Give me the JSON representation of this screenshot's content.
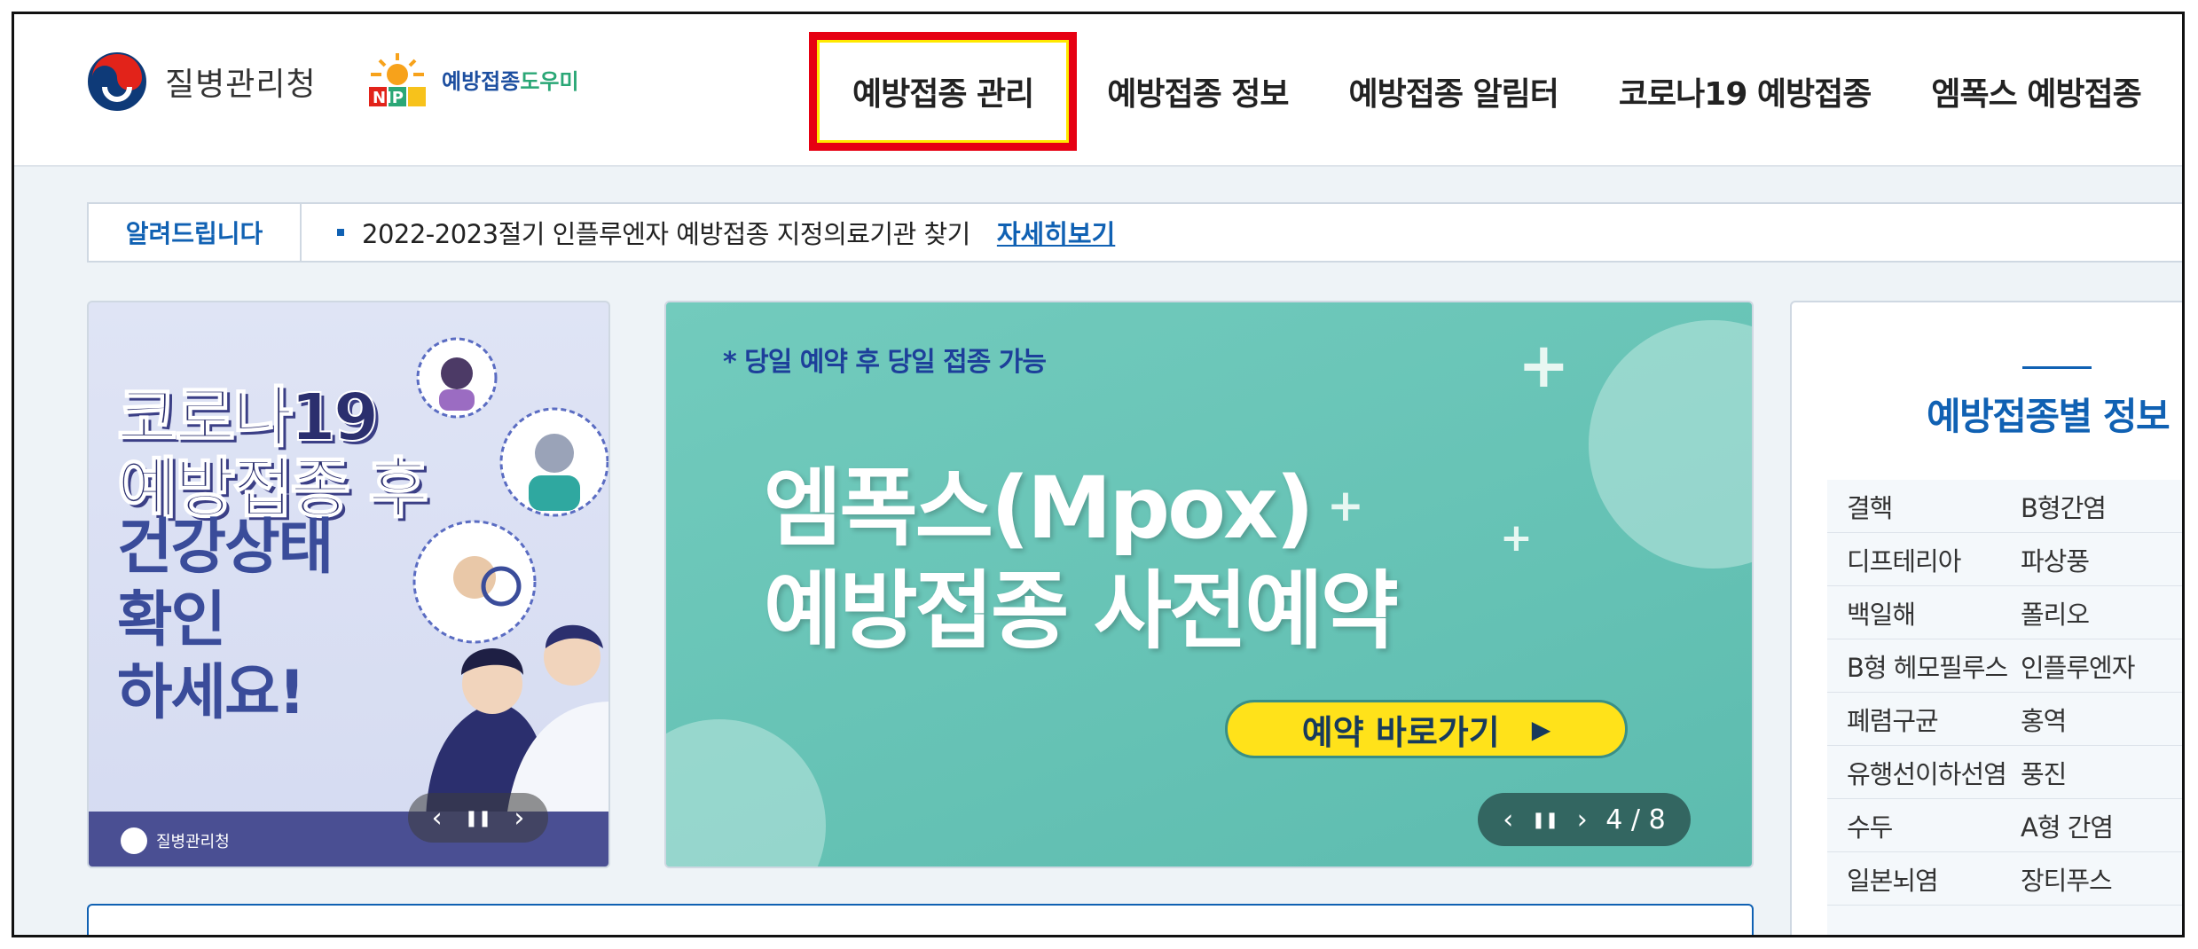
{
  "header": {
    "org_name": "질병관리청",
    "nip_name_a": "예방접종",
    "nip_name_b": "도우미",
    "nip_letters": "NIP",
    "nav": [
      {
        "label": "예방접종 관리",
        "active": true
      },
      {
        "label": "예방접종 정보",
        "active": false
      },
      {
        "label": "예방접종 알림터",
        "active": false
      },
      {
        "label": "코로나19 예방접종",
        "active": false
      },
      {
        "label": "엠폭스 예방접종",
        "active": false
      }
    ]
  },
  "notice": {
    "tag": "알려드립니다",
    "text": "2022-2023절기 인플루엔자 예방접종 지정의료기관 찾기",
    "link": "자세히보기"
  },
  "banner_left": {
    "line1": "코로나19",
    "line2": "예방접종 후",
    "line3a": "건강상태",
    "line3b": "확인",
    "line3c": "하세요!",
    "footer_org": "질병관리청",
    "pager_prev": "‹",
    "pager_pause": "❚❚",
    "pager_next": "›"
  },
  "banner_main": {
    "subtitle": "* 당일 예약 후 당일 접종 가능",
    "title_line1": "엠폭스(Mpox)",
    "title_line2": "예방접종 사전예약",
    "cta": "예약 바로가기",
    "cta_arrow": "▶",
    "pager_prev": "‹",
    "pager_pause": "❚❚",
    "pager_next": "›",
    "pager_count": "4 / 8"
  },
  "info_panel": {
    "title": "예방접종별 정보",
    "rows": [
      [
        "결핵",
        "B형간염"
      ],
      [
        "디프테리아",
        "파상풍"
      ],
      [
        "백일해",
        "폴리오"
      ],
      [
        "B형 헤모필루스",
        "인플루엔자"
      ],
      [
        "폐렴구균",
        "홍역"
      ],
      [
        "유행선이하선염",
        "풍진"
      ],
      [
        "수두",
        "A형 간염"
      ],
      [
        "일본뇌염",
        "장티푸스"
      ]
    ]
  },
  "colors": {
    "accent": "#1061b3",
    "highlight_border": "#e60012",
    "highlight_outline": "#ffe900",
    "banner_teal": "#5dbcaf",
    "cta_yellow": "#ffe21a"
  }
}
